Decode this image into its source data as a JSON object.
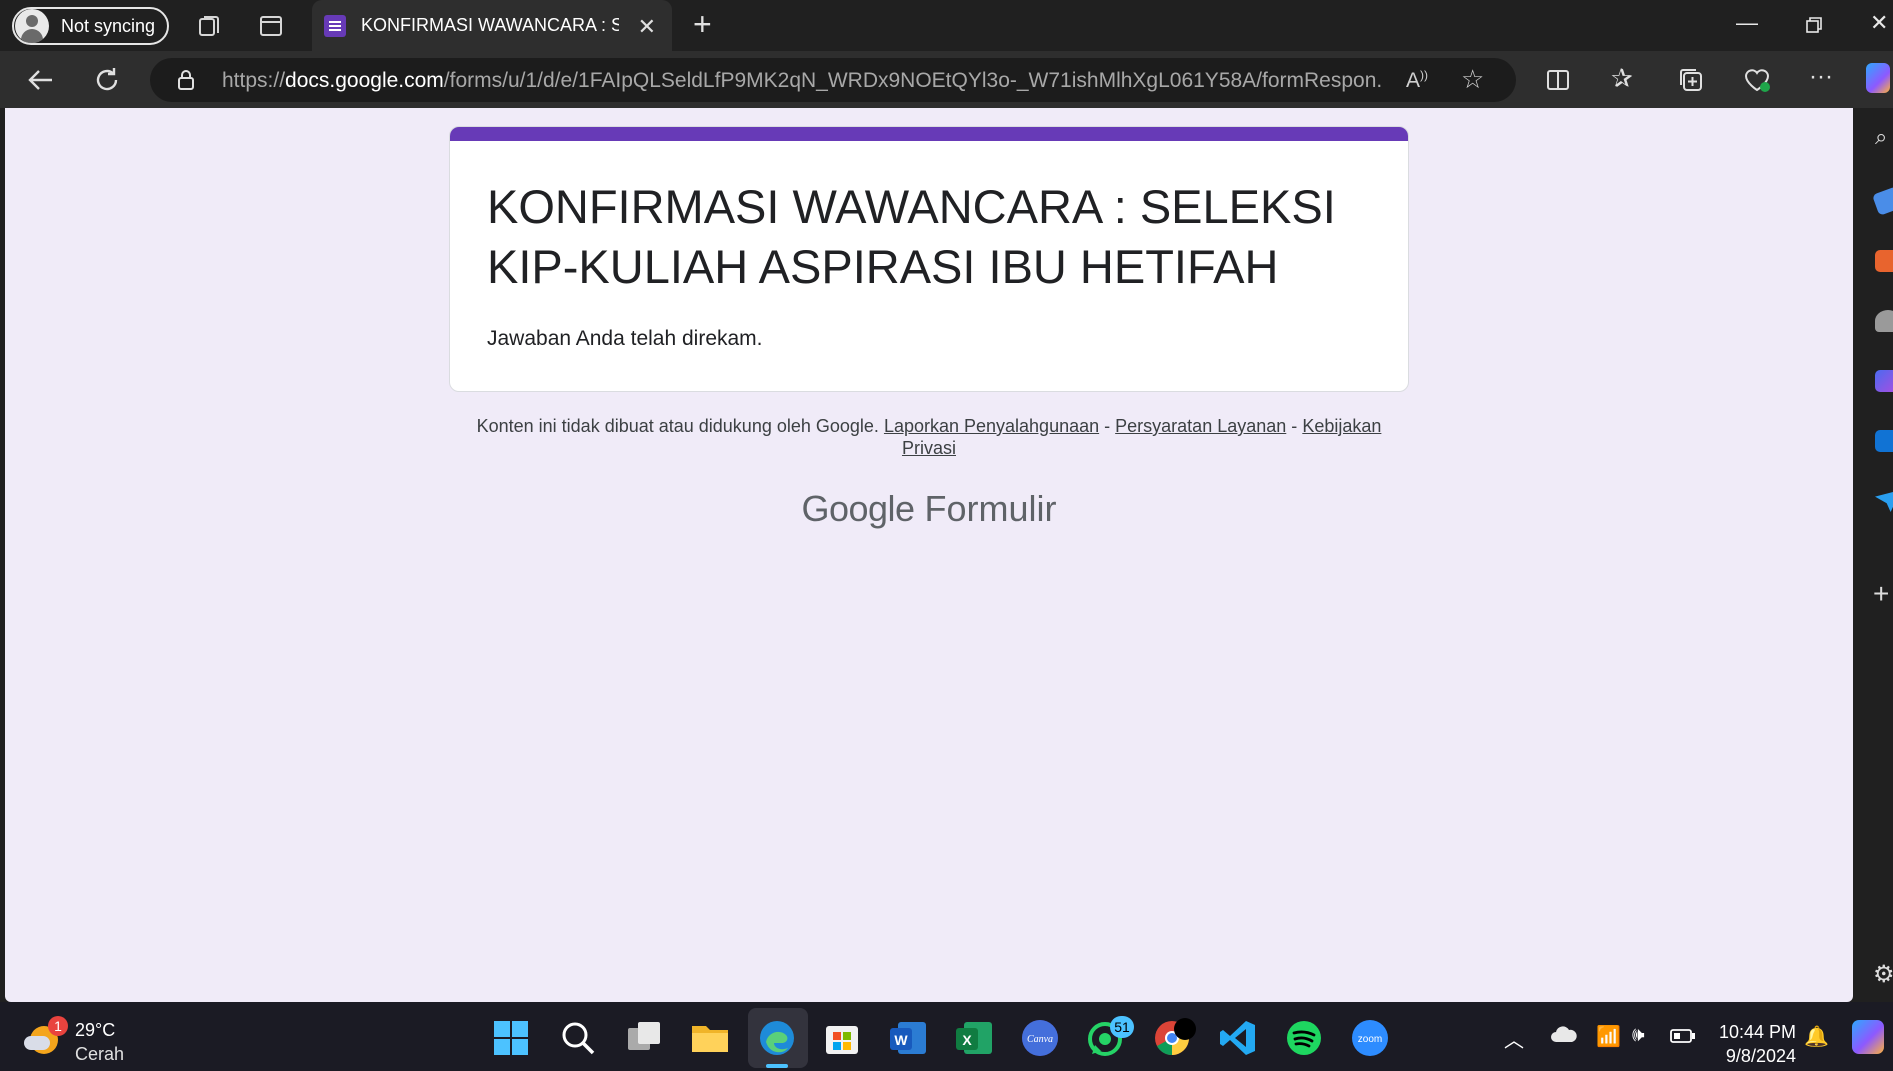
{
  "browser": {
    "profile_label": "Not syncing",
    "tab_title": "KONFIRMASI WAWANCARA : SELEKSI",
    "url_prefix": "https://",
    "url_host": "docs.google.com",
    "url_path": "/forms/u/1/d/e/1FAIpQLSeldLfP9MK2qN_WRDx9NOEtQYl3o-_W71ishMlhXgL061Y58A/formRespon..."
  },
  "form": {
    "title_line1": "KONFIRMASI WAWANCARA : SELEKSI",
    "title_line2": "KIP-KULIAH ASPIRASI IBU HETIFAH",
    "message": "Jawaban Anda telah direkam.",
    "accent_color": "#673ab7",
    "background_color": "#f0ebf8"
  },
  "footer": {
    "disclaimer": "Konten ini tidak dibuat atau didukung oleh Google.",
    "link_report": "Laporkan Penyalahgunaan",
    "sep1": "-",
    "link_terms": "Persyaratan Layanan",
    "sep2": "-",
    "link_privacy": "Kebijakan Privasi",
    "logo_google": "Google",
    "logo_product": "Formulir"
  },
  "taskbar": {
    "weather_temp": "29°C",
    "weather_condition": "Cerah",
    "weather_badge": "1",
    "whatsapp_badge": "51",
    "time": "10:44 PM",
    "date": "9/8/2024",
    "apps": [
      "start-icon",
      "search-icon",
      "task-view-icon",
      "file-explorer-icon",
      "edge-icon",
      "store-icon",
      "word-icon",
      "excel-icon",
      "canva-icon",
      "whatsapp-icon",
      "chrome-icon",
      "vscode-icon",
      "spotify-icon",
      "zoom-icon"
    ]
  }
}
